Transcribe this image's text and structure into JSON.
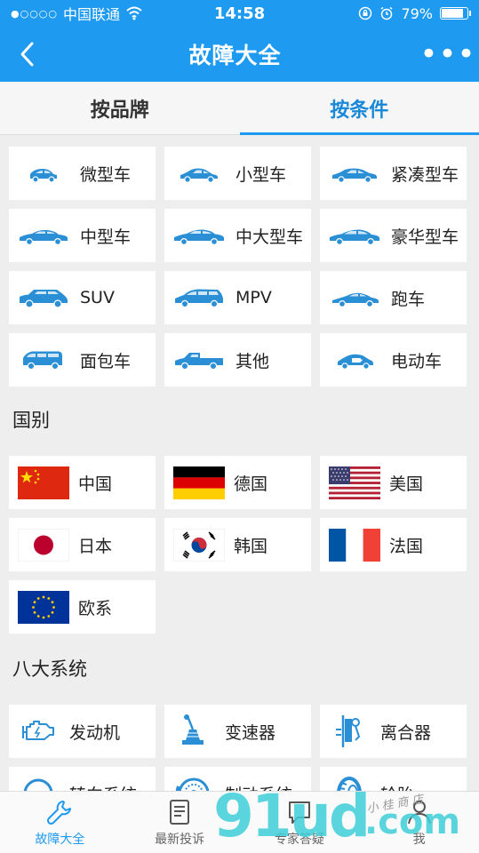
{
  "status_bar": {
    "signal": "●○○○○",
    "carrier": "中国联通",
    "time": "14:58",
    "battery_text": "79%",
    "battery_level": 0.79
  },
  "nav": {
    "title": "故障大全",
    "more": "•••"
  },
  "tabs": [
    {
      "label": "按品牌",
      "active": false
    },
    {
      "label": "按条件",
      "active": true
    }
  ],
  "car_types": [
    {
      "label": "微型车",
      "icon": "mini-car-icon"
    },
    {
      "label": "小型车",
      "icon": "small-car-icon"
    },
    {
      "label": "紧凑型车",
      "icon": "compact-car-icon"
    },
    {
      "label": "中型车",
      "icon": "midsize-car-icon"
    },
    {
      "label": "中大型车",
      "icon": "large-car-icon"
    },
    {
      "label": "豪华型车",
      "icon": "luxury-car-icon"
    },
    {
      "label": "SUV",
      "icon": "suv-icon"
    },
    {
      "label": "MPV",
      "icon": "mpv-icon"
    },
    {
      "label": "跑车",
      "icon": "sports-car-icon"
    },
    {
      "label": "面包车",
      "icon": "van-icon"
    },
    {
      "label": "其他",
      "icon": "pickup-truck-icon"
    },
    {
      "label": "电动车",
      "icon": "electric-car-icon"
    }
  ],
  "country_section": {
    "title": "国别",
    "items": [
      {
        "label": "中国",
        "icon": "china-flag-icon"
      },
      {
        "label": "德国",
        "icon": "germany-flag-icon"
      },
      {
        "label": "美国",
        "icon": "usa-flag-icon"
      },
      {
        "label": "日本",
        "icon": "japan-flag-icon"
      },
      {
        "label": "韩国",
        "icon": "korea-flag-icon"
      },
      {
        "label": "法国",
        "icon": "france-flag-icon"
      },
      {
        "label": "欧系",
        "icon": "eu-flag-icon"
      }
    ]
  },
  "systems_section": {
    "title": "八大系统",
    "items": [
      {
        "label": "发动机",
        "icon": "engine-icon"
      },
      {
        "label": "变速器",
        "icon": "gear-shift-icon"
      },
      {
        "label": "离合器",
        "icon": "clutch-icon"
      },
      {
        "label": "转向系统",
        "icon": "steering-wheel-icon"
      },
      {
        "label": "制动系统",
        "icon": "brake-disc-icon"
      },
      {
        "label": "轮胎",
        "icon": "tire-icon"
      }
    ]
  },
  "bottom_nav": [
    {
      "label": "故障大全",
      "icon": "wrench-icon",
      "active": true
    },
    {
      "label": "最新投诉",
      "icon": "document-icon",
      "active": false
    },
    {
      "label": "专家答疑",
      "icon": "chat-icon",
      "active": false
    },
    {
      "label": "我",
      "icon": "user-icon",
      "active": false
    }
  ],
  "watermark": {
    "big": "91ud",
    "com": ".com",
    "small": "小 桂 商 店"
  },
  "colors": {
    "primary": "#1e9af0",
    "icon_blue": "#2b8fd6",
    "background": "#eeeeee"
  }
}
